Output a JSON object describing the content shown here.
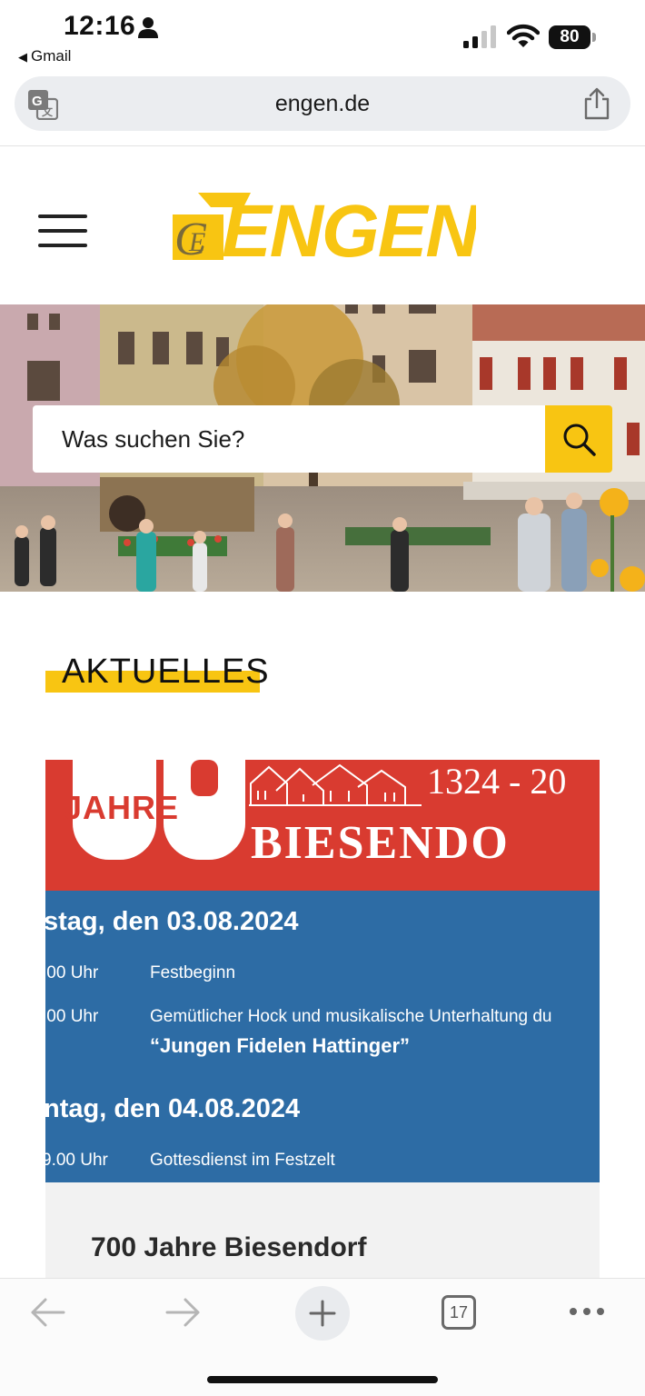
{
  "status_bar": {
    "time": "12:16",
    "back_app": "Gmail",
    "battery": "80"
  },
  "browser": {
    "url": "engen.de",
    "open_tabs": "17"
  },
  "site": {
    "logo_text": "ENGEN",
    "brand_color": "#f8c512",
    "search_placeholder": "Was suchen Sie?"
  },
  "section": {
    "title": "AKTUELLES"
  },
  "news": {
    "image": {
      "jahre": "JAHRE",
      "years": "1324 - 20",
      "village": "BIESENDO",
      "day1": "stag, den 03.08.2024",
      "day1_events": [
        {
          "time": ".00 Uhr",
          "text": "Festbeginn"
        },
        {
          "time": ".00 Uhr",
          "text": "Gemütlicher Hock und musikalische Unterhaltung du",
          "subtext": "“Jungen Fidelen Hattinger”"
        }
      ],
      "day2": "ntag, den 04.08.2024",
      "day2_events": [
        {
          "time": "9.00 Uhr",
          "text": "Gottesdienst im Festzelt"
        }
      ]
    },
    "title": "700 Jahre Biesendorf"
  },
  "icons": {
    "person": "person-icon",
    "signal": "cellular-signal-icon",
    "wifi": "wifi-icon",
    "translate": "translate-icon",
    "share": "share-icon",
    "menu": "hamburger-menu-icon",
    "search": "search-icon",
    "back": "back-arrow-icon",
    "forward": "forward-arrow-icon",
    "new_tab": "plus-icon",
    "more": "more-dots-icon"
  }
}
